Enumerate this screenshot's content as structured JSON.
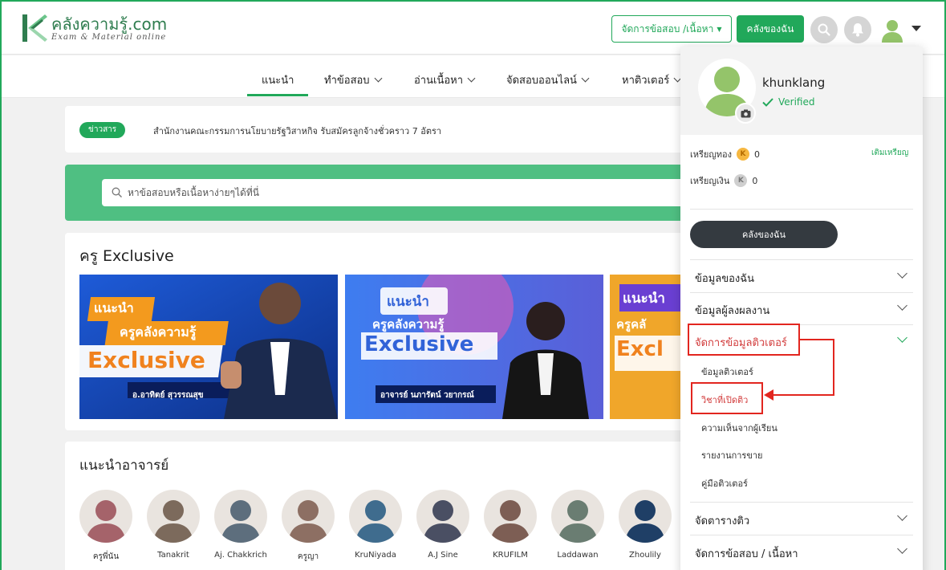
{
  "header": {
    "logo_name": "คลังความรู้.com",
    "logo_sub": "Exam & Material online",
    "manage_button": "จัดการข้อสอบ /เนื้อหา",
    "mine_button": "คลังของฉัน"
  },
  "nav": {
    "items": [
      "แนะนำ",
      "ทำข้อสอบ",
      "อ่านเนื้อหา",
      "จัดสอบออนไลน์",
      "หาติวเตอร์"
    ]
  },
  "news": {
    "badge": "ข่าวสาร",
    "text": "สำนักงานคณะกรรมการนโยบายรัฐวิสาหกิจ รับสมัครลูกจ้างชั่วคราว 7 อัตรา"
  },
  "search": {
    "placeholder": "หาข้อสอบหรือเนื้อหาง่ายๆได้ที่นี่"
  },
  "exclusive": {
    "title": "ครู Exclusive",
    "banners": [
      {
        "headline1": "แนะนำ",
        "headline2": "ครูคลังความรู้",
        "headline3": "Exclusive",
        "caption": "อ.อาทิตย์ สุวรรณสุข"
      },
      {
        "headline1": "แนะนำ",
        "headline2": "ครูคลังความรู้",
        "headline3": "Exclusive",
        "caption": "อาจารย์ นภารัตน์ วยากรณ์"
      },
      {
        "headline1": "แนะนำ",
        "headline2": "ครูคลั",
        "headline3": "Excl",
        "caption": ""
      }
    ]
  },
  "teachers": {
    "title": "แนะนำอาจารย์",
    "list": [
      "ครูพี่นัน",
      "Tanakrit",
      "Aj. Chakkrich",
      "ครูญา",
      "KruNiyada",
      "A.J Sine",
      "KRUFILM",
      "Laddawan",
      "Zhoulily"
    ]
  },
  "panel": {
    "username": "khunklang",
    "verified": "Verified",
    "gold_label": "เหรียญทอง",
    "gold_value": "0",
    "silver_label": "เหรียญเงิน",
    "silver_value": "0",
    "coin_symbol": "K",
    "topup": "เติมเหรียญ",
    "mine_button": "คลังของฉัน",
    "sections": [
      "ข้อมูลของฉัน",
      "ข้อมูลผู้ลงผลงาน",
      "จัดการข้อมูลติวเตอร์",
      "จัดตารางติว",
      "จัดการข้อสอบ / เนื้อหา"
    ],
    "tutor_sub": [
      "ข้อมูลติวเตอร์",
      "วิชาที่เปิดติว",
      "ความเห็นจากผู้เรียน",
      "รายงานการขาย",
      "คู่มือติวเตอร์"
    ]
  },
  "colors": {
    "brand_green": "#21a85a",
    "search_band": "#4fbf82",
    "highlight_red": "#e2261f"
  }
}
